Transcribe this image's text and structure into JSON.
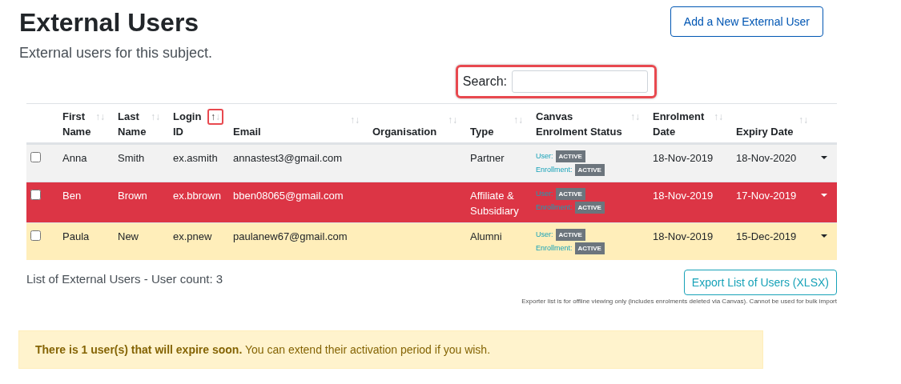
{
  "title": "External Users",
  "subtitle": "External users for this subject.",
  "add_button": "Add a New External User",
  "search": {
    "label": "Search:",
    "highlighted": true
  },
  "table": {
    "columns": [
      {
        "label": "First Name",
        "sort_up": "↑",
        "sort_down": "↓",
        "sorted": false,
        "highlighted": false
      },
      {
        "label": "Last Name",
        "sort_up": "↑",
        "sort_down": "↓",
        "sorted": false,
        "highlighted": false
      },
      {
        "label": "Login ID",
        "sort_up": "↑",
        "sort_down": "↓",
        "sorted": true,
        "highlighted": true
      },
      {
        "label": "Email",
        "sort_up": "↑",
        "sort_down": "↓",
        "sorted": false,
        "highlighted": false
      },
      {
        "label": "Organisation",
        "sort_up": "↑",
        "sort_down": "↓",
        "sorted": false,
        "highlighted": false
      },
      {
        "label": "Type",
        "sort_up": "↑",
        "sort_down": "↓",
        "sorted": false,
        "highlighted": false
      },
      {
        "label": "Canvas Enrolment Status",
        "sort_up": "↑",
        "sort_down": "↓",
        "sorted": false,
        "highlighted": false
      },
      {
        "label": "Enrolment Date",
        "sort_up": "↑",
        "sort_down": "↓",
        "sorted": false,
        "highlighted": false
      },
      {
        "label": "Expiry Date",
        "sort_up": "↑",
        "sort_down": "↓",
        "sorted": false,
        "highlighted": false
      }
    ],
    "rows": [
      {
        "kind": "default",
        "checked": false,
        "first": "Anna",
        "last": "Smith",
        "login": "ex.asmith",
        "email": "annastest3@gmail.com",
        "type": "Partner",
        "status": [
          {
            "label": "User:",
            "badge": "ACTIVE"
          },
          {
            "label": "Enrollment:",
            "badge": "ACTIVE"
          }
        ],
        "enrolment": "18-Nov-2019",
        "expiry": "18-Nov-2020"
      },
      {
        "kind": "danger",
        "checked": false,
        "first": "Ben",
        "last": "Brown",
        "login": "ex.bbrown",
        "email": "bben08065@gmail.com",
        "type": "Affiliate & Subsidiary",
        "status": [
          {
            "label": "User:",
            "badge": "ACTIVE"
          },
          {
            "label": "Enrollment:",
            "badge": "ACTIVE"
          }
        ],
        "enrolment": "18-Nov-2019",
        "expiry": "17-Nov-2019"
      },
      {
        "kind": "warning",
        "checked": false,
        "first": "Paula",
        "last": "New",
        "login": "ex.pnew",
        "email": "paulanew67@gmail.com",
        "type": "Alumni",
        "status": [
          {
            "label": "User:",
            "badge": "ACTIVE"
          },
          {
            "label": "Enrollment:",
            "badge": "ACTIVE"
          }
        ],
        "enrolment": "18-Nov-2019",
        "expiry": "15-Dec-2019"
      }
    ]
  },
  "user_count": "List of External Users - User count: 3",
  "export_button": "Export List of Users (XLSX)",
  "export_note": "Exporter list is for offline viewing only (includes enrolments deleted via Canvas). Cannot be used for bulk import",
  "alert": "**There is 1 user(s) that will expire soon.** You can extend their activation period if you wish."
}
